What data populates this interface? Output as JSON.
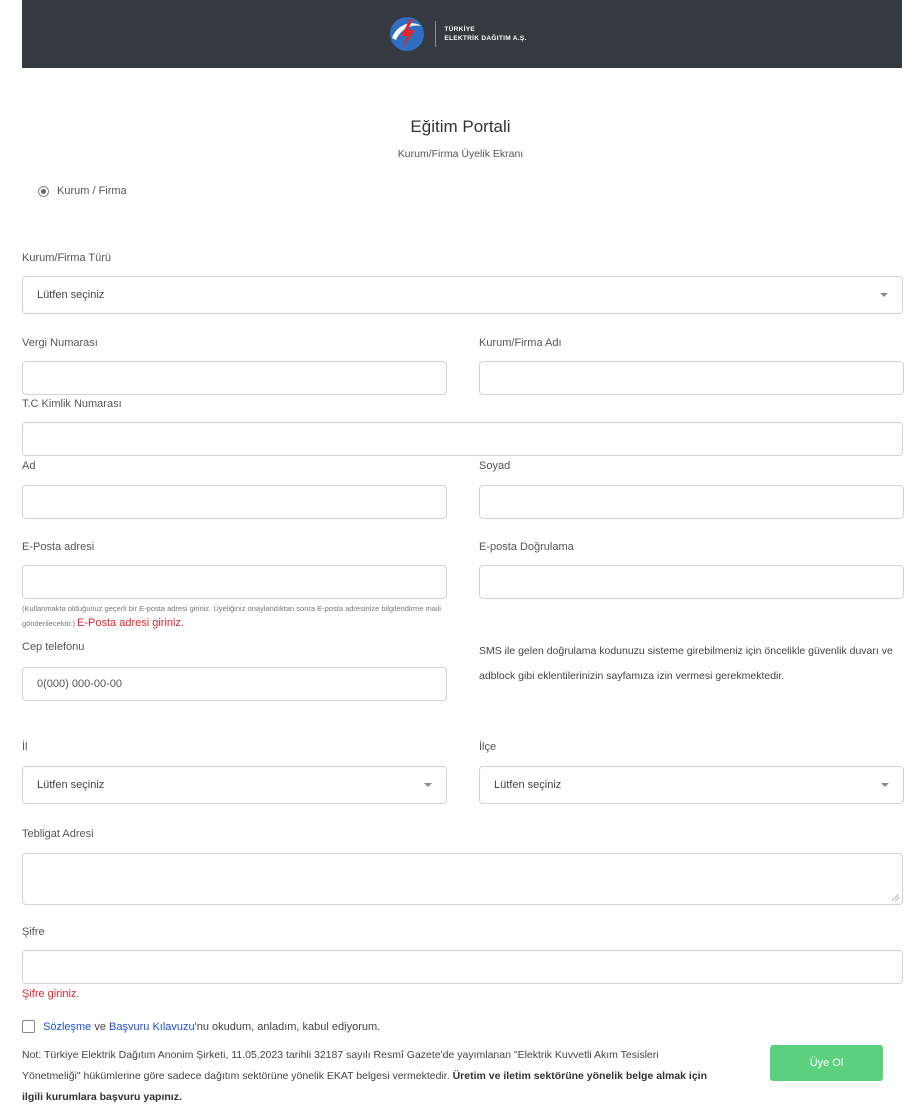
{
  "header": {
    "logo_line1": "TÜRKİYE",
    "logo_line2": "ELEKTRİK DAĞITIM A.Ş.",
    "logo_colors": {
      "red": "#e3262d",
      "blue": "#2e6fc3"
    }
  },
  "page": {
    "title": "Eğitim Portali",
    "subtitle": "Kurum/Firma Üyelik Ekranı"
  },
  "radio": {
    "label": "Kurum / Firma",
    "checked": true
  },
  "form": {
    "type_label": "Kurum/Firma Türü",
    "type_value": "Lütfen seçiniz",
    "tax_label": "Vergi Numarası",
    "company_label": "Kurum/Firma Adı",
    "tc_label": "T.C Kimlik Numarası",
    "name_label": "Ad",
    "surname_label": "Soyad",
    "email_label": "E-Posta adresi",
    "email_confirm_label": "E-posta Doğrulama",
    "email_help": "(Kullanmakta olduğunuz geçerli bir E-posta adresi giriniz. Üyeliğiniz onaylandıktan sonra E-posta adresinize bilgilendirme maili gönderilecektir.)",
    "email_error": "E-Posta adresi giriniz.",
    "phone_label": "Cep telefonu",
    "phone_placeholder": "0(000) 000-00-00",
    "sms_note": "SMS ile gelen doğrulama kodunuzu sisteme girebilmeniz için öncelikle güvenlik duvarı ve adblock gibi eklentilerinizin sayfamıza izin vermesi gerekmektedir.",
    "city_label": "İl",
    "city_value": "Lütfen seçiniz",
    "district_label": "İlçe",
    "district_value": "Lütfen seçiniz",
    "address_label": "Tebligat Adresi",
    "password_label": "Şifre",
    "password_error": "Şifre giriniz."
  },
  "agreement": {
    "link1": "Sözleşme",
    "conj": "ve",
    "link2": "Başvuru Kılavuzu",
    "rest": "'nu okudum, anladım, kabul ediyorum."
  },
  "note": {
    "text": "Not: Türkiye Elektrik Dağıtım Anonim Şirketi, 11.05.2023 tarihli 32187 sayılı Resmî Gazete'de yayımlanan \"Elektrik Kuvvetli Akım Tesisleri Yönetmeliği\" hükümlerine göre sadece dağıtım sektörüne yönelik EKAT belgesi vermektedir.",
    "bold": "Üretim ve iletim sektörüne yönelik belge almak için ilgili kurumlara başvuru yapınız."
  },
  "submit": {
    "label": "Üye Ol",
    "color": "#5bd07f"
  }
}
